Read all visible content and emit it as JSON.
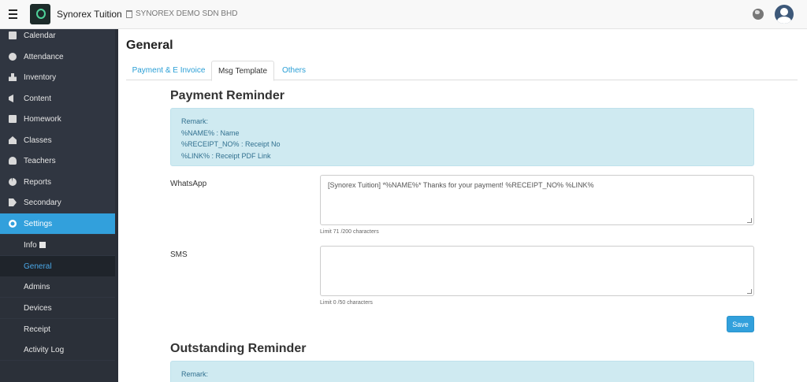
{
  "header": {
    "brand": "Synorex Tuition",
    "company": "SYNOREX DEMO SDN BHD"
  },
  "sidebar": {
    "items": [
      {
        "label": "Calendar",
        "icon": "calendar-icon"
      },
      {
        "label": "Attendance",
        "icon": "clock-icon"
      },
      {
        "label": "Inventory",
        "icon": "boxes-icon"
      },
      {
        "label": "Content",
        "icon": "bullhorn-icon"
      },
      {
        "label": "Homework",
        "icon": "book-icon"
      },
      {
        "label": "Classes",
        "icon": "school-icon"
      },
      {
        "label": "Teachers",
        "icon": "user-icon"
      },
      {
        "label": "Reports",
        "icon": "pie-chart-icon"
      },
      {
        "label": "Secondary",
        "icon": "tag-icon"
      },
      {
        "label": "Settings",
        "icon": "gears-icon"
      }
    ],
    "subitems": [
      {
        "label": "Info"
      },
      {
        "label": "General"
      },
      {
        "label": "Admins"
      },
      {
        "label": "Devices"
      },
      {
        "label": "Receipt"
      },
      {
        "label": "Activity Log"
      }
    ]
  },
  "page": {
    "title": "General",
    "tabs": [
      {
        "label": "Payment & E Invoice"
      },
      {
        "label": "Msg Template"
      },
      {
        "label": "Others"
      }
    ]
  },
  "payment_reminder": {
    "title": "Payment Reminder",
    "remark_lines": [
      "Remark:",
      "%NAME% : Name",
      "%RECEIPT_NO% : Receipt No",
      "%LINK% : Receipt PDF Link"
    ],
    "whatsapp_label": "WhatsApp",
    "whatsapp_value": "[Synorex Tuition] *%NAME%* Thanks for your payment! %RECEIPT_NO% %LINK%",
    "whatsapp_limit": "Limit 71 /200 characters",
    "sms_label": "SMS",
    "sms_value": "",
    "sms_limit": "Limit 0 /50 characters",
    "save_label": "Save"
  },
  "outstanding_reminder": {
    "title": "Outstanding Reminder",
    "remark_lines": [
      "Remark:"
    ]
  },
  "colors": {
    "sidebar_bg": "#303641",
    "accent": "#32a0dc",
    "remark_bg": "#cfeaf1",
    "remark_text": "#31708f"
  }
}
